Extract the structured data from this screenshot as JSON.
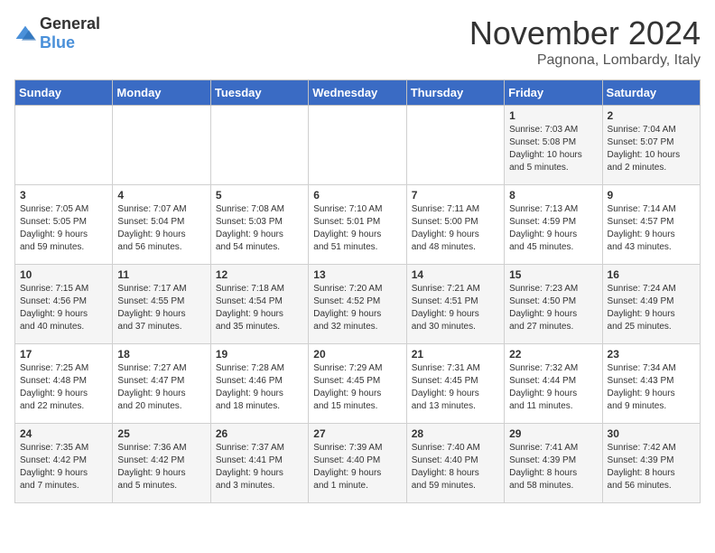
{
  "logo": {
    "general": "General",
    "blue": "Blue"
  },
  "header": {
    "month": "November 2024",
    "location": "Pagnona, Lombardy, Italy"
  },
  "days_of_week": [
    "Sunday",
    "Monday",
    "Tuesday",
    "Wednesday",
    "Thursday",
    "Friday",
    "Saturday"
  ],
  "weeks": [
    [
      {
        "day": "",
        "info": ""
      },
      {
        "day": "",
        "info": ""
      },
      {
        "day": "",
        "info": ""
      },
      {
        "day": "",
        "info": ""
      },
      {
        "day": "",
        "info": ""
      },
      {
        "day": "1",
        "info": "Sunrise: 7:03 AM\nSunset: 5:08 PM\nDaylight: 10 hours\nand 5 minutes."
      },
      {
        "day": "2",
        "info": "Sunrise: 7:04 AM\nSunset: 5:07 PM\nDaylight: 10 hours\nand 2 minutes."
      }
    ],
    [
      {
        "day": "3",
        "info": "Sunrise: 7:05 AM\nSunset: 5:05 PM\nDaylight: 9 hours\nand 59 minutes."
      },
      {
        "day": "4",
        "info": "Sunrise: 7:07 AM\nSunset: 5:04 PM\nDaylight: 9 hours\nand 56 minutes."
      },
      {
        "day": "5",
        "info": "Sunrise: 7:08 AM\nSunset: 5:03 PM\nDaylight: 9 hours\nand 54 minutes."
      },
      {
        "day": "6",
        "info": "Sunrise: 7:10 AM\nSunset: 5:01 PM\nDaylight: 9 hours\nand 51 minutes."
      },
      {
        "day": "7",
        "info": "Sunrise: 7:11 AM\nSunset: 5:00 PM\nDaylight: 9 hours\nand 48 minutes."
      },
      {
        "day": "8",
        "info": "Sunrise: 7:13 AM\nSunset: 4:59 PM\nDaylight: 9 hours\nand 45 minutes."
      },
      {
        "day": "9",
        "info": "Sunrise: 7:14 AM\nSunset: 4:57 PM\nDaylight: 9 hours\nand 43 minutes."
      }
    ],
    [
      {
        "day": "10",
        "info": "Sunrise: 7:15 AM\nSunset: 4:56 PM\nDaylight: 9 hours\nand 40 minutes."
      },
      {
        "day": "11",
        "info": "Sunrise: 7:17 AM\nSunset: 4:55 PM\nDaylight: 9 hours\nand 37 minutes."
      },
      {
        "day": "12",
        "info": "Sunrise: 7:18 AM\nSunset: 4:54 PM\nDaylight: 9 hours\nand 35 minutes."
      },
      {
        "day": "13",
        "info": "Sunrise: 7:20 AM\nSunset: 4:52 PM\nDaylight: 9 hours\nand 32 minutes."
      },
      {
        "day": "14",
        "info": "Sunrise: 7:21 AM\nSunset: 4:51 PM\nDaylight: 9 hours\nand 30 minutes."
      },
      {
        "day": "15",
        "info": "Sunrise: 7:23 AM\nSunset: 4:50 PM\nDaylight: 9 hours\nand 27 minutes."
      },
      {
        "day": "16",
        "info": "Sunrise: 7:24 AM\nSunset: 4:49 PM\nDaylight: 9 hours\nand 25 minutes."
      }
    ],
    [
      {
        "day": "17",
        "info": "Sunrise: 7:25 AM\nSunset: 4:48 PM\nDaylight: 9 hours\nand 22 minutes."
      },
      {
        "day": "18",
        "info": "Sunrise: 7:27 AM\nSunset: 4:47 PM\nDaylight: 9 hours\nand 20 minutes."
      },
      {
        "day": "19",
        "info": "Sunrise: 7:28 AM\nSunset: 4:46 PM\nDaylight: 9 hours\nand 18 minutes."
      },
      {
        "day": "20",
        "info": "Sunrise: 7:29 AM\nSunset: 4:45 PM\nDaylight: 9 hours\nand 15 minutes."
      },
      {
        "day": "21",
        "info": "Sunrise: 7:31 AM\nSunset: 4:45 PM\nDaylight: 9 hours\nand 13 minutes."
      },
      {
        "day": "22",
        "info": "Sunrise: 7:32 AM\nSunset: 4:44 PM\nDaylight: 9 hours\nand 11 minutes."
      },
      {
        "day": "23",
        "info": "Sunrise: 7:34 AM\nSunset: 4:43 PM\nDaylight: 9 hours\nand 9 minutes."
      }
    ],
    [
      {
        "day": "24",
        "info": "Sunrise: 7:35 AM\nSunset: 4:42 PM\nDaylight: 9 hours\nand 7 minutes."
      },
      {
        "day": "25",
        "info": "Sunrise: 7:36 AM\nSunset: 4:42 PM\nDaylight: 9 hours\nand 5 minutes."
      },
      {
        "day": "26",
        "info": "Sunrise: 7:37 AM\nSunset: 4:41 PM\nDaylight: 9 hours\nand 3 minutes."
      },
      {
        "day": "27",
        "info": "Sunrise: 7:39 AM\nSunset: 4:40 PM\nDaylight: 9 hours\nand 1 minute."
      },
      {
        "day": "28",
        "info": "Sunrise: 7:40 AM\nSunset: 4:40 PM\nDaylight: 8 hours\nand 59 minutes."
      },
      {
        "day": "29",
        "info": "Sunrise: 7:41 AM\nSunset: 4:39 PM\nDaylight: 8 hours\nand 58 minutes."
      },
      {
        "day": "30",
        "info": "Sunrise: 7:42 AM\nSunset: 4:39 PM\nDaylight: 8 hours\nand 56 minutes."
      }
    ]
  ]
}
